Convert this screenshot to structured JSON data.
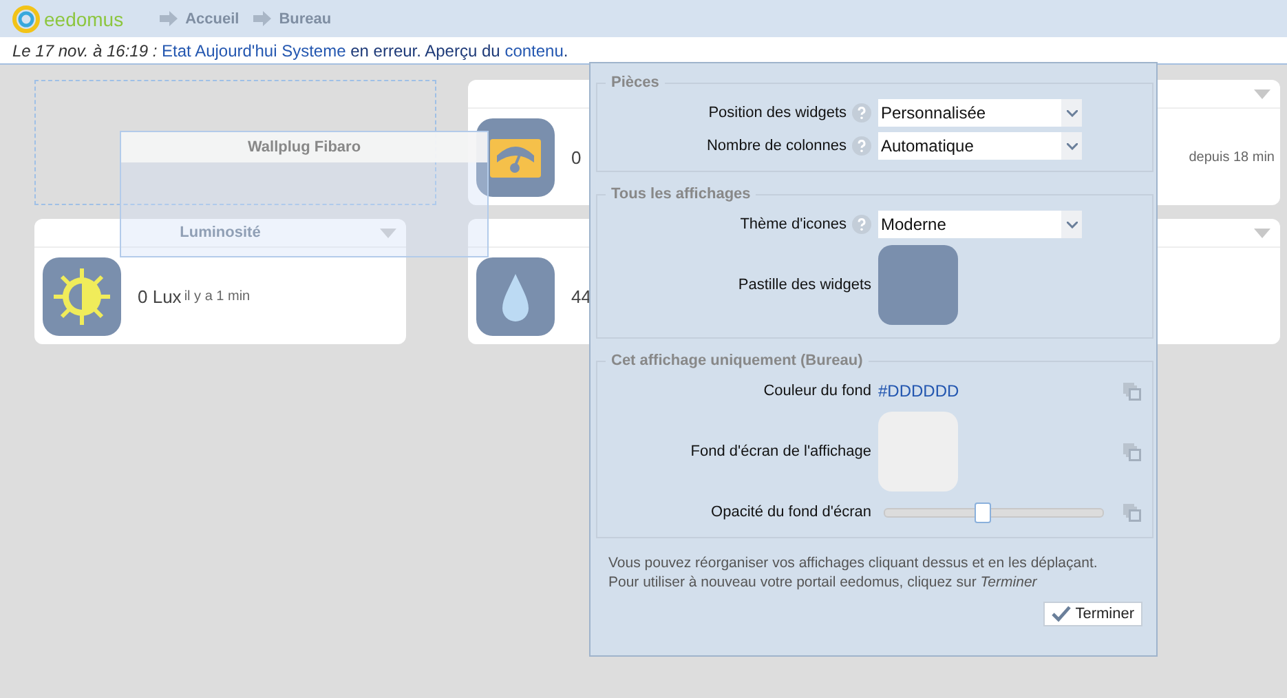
{
  "header": {
    "logo": "eedomus",
    "breadcrumbs": [
      "Accueil",
      "Bureau"
    ]
  },
  "notification": [
    {
      "kind": "date",
      "text": "Le 17 nov. à 16:19 :"
    },
    {
      "kind": "link",
      "text": "Etat Aujourd'hui Systeme"
    },
    {
      "kind": "text",
      "text": "en erreur. Aperçu du"
    },
    {
      "kind": "link",
      "text": "contenu"
    },
    {
      "kind": "end",
      "text": "."
    }
  ],
  "widgets": [
    {
      "kind": "placeholder"
    },
    {
      "kind": "card",
      "value": "0"
    },
    {
      "kind": "card",
      "title": "Luminosité",
      "value": "0 Lux",
      "time": "il y a 1 min"
    },
    {
      "kind": "card",
      "value": "44"
    }
  ],
  "side_time": "depuis 18 min",
  "dragged_widget": {
    "title": "Wallplug Fibaro"
  },
  "panel": {
    "sections": [
      {
        "title": "Pièces",
        "rows": [
          {
            "kind": "select",
            "label": "Position des widgets",
            "help": true,
            "value": "Personnalisée"
          },
          {
            "kind": "select",
            "label": "Nombre de colonnes",
            "help": true,
            "value": "Automatique"
          }
        ]
      },
      {
        "title": "Tous les affichages",
        "rows": [
          {
            "kind": "select",
            "label": "Thème d'icones",
            "help": true,
            "value": "Moderne"
          },
          {
            "kind": "swatch",
            "label": "Pastille des widgets"
          }
        ]
      },
      {
        "title": "Cet affichage uniquement (Bureau)",
        "rows": [
          {
            "kind": "color",
            "label": "Couleur du fond",
            "value": "#DDDDDD",
            "copyable": true
          },
          {
            "kind": "image",
            "label": "Fond d'écran de l'affichage",
            "copyable": true
          },
          {
            "kind": "slider",
            "label": "Opacité du fond d'écran",
            "level": 0.45,
            "copyable": true
          }
        ]
      }
    ],
    "note": [
      "Vous pouvez réorganiser vos affichages cliquant dessus et en les déplaçant.",
      "Pour utiliser à nouveau votre portail eedomus, cliquez sur *Terminer*"
    ],
    "button": "Terminer"
  }
}
